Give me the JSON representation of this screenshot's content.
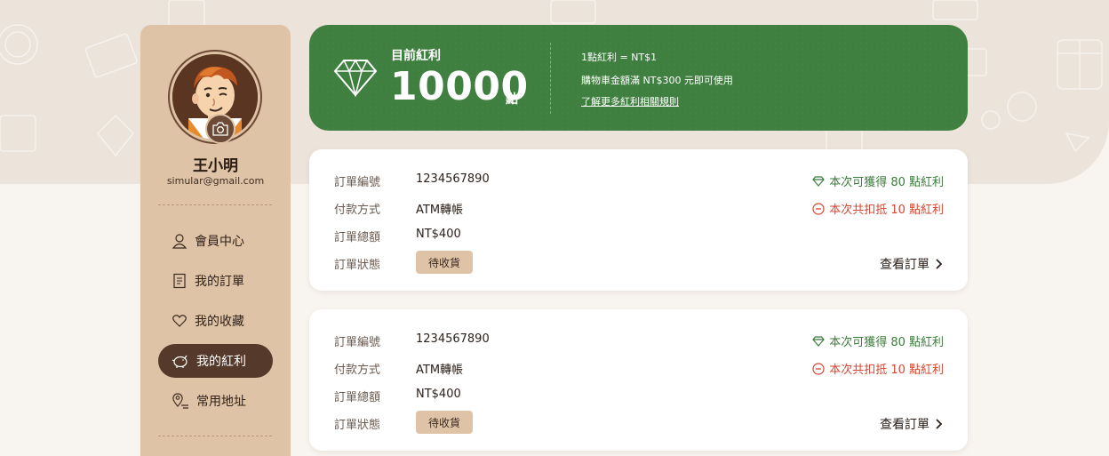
{
  "user": {
    "name": "王小明",
    "email": "simular@gmail.com"
  },
  "menu": {
    "items": [
      {
        "label": "會員中心",
        "icon": "user-icon"
      },
      {
        "label": "我的訂單",
        "icon": "receipt-icon"
      },
      {
        "label": "我的收藏",
        "icon": "heart-icon"
      },
      {
        "label": "我的紅利",
        "icon": "piggy-bank-icon",
        "active": true
      },
      {
        "label": "常用地址",
        "icon": "location-pin-icon"
      }
    ]
  },
  "bonus": {
    "title": "目前紅利",
    "points": "10000",
    "unit": "點",
    "rule1": "1點紅利 = NT$1",
    "rule2": "購物車金額滿 NT$300 元即可使用",
    "link": "了解更多紅利相關規則"
  },
  "labels": {
    "order_no": "訂單編號",
    "payment": "付款方式",
    "total": "訂單總額",
    "status": "訂單狀態",
    "view": "查看訂單"
  },
  "orders": [
    {
      "order_no": "1234567890",
      "payment": "ATM轉帳",
      "total": "NT$400",
      "status": "待收貨",
      "gain": "本次可獲得 80 點紅利",
      "deduct": "本次共扣抵 10 點紅利"
    },
    {
      "order_no": "1234567890",
      "payment": "ATM轉帳",
      "total": "NT$400",
      "status": "待收貨",
      "gain": "本次可獲得 80 點紅利",
      "deduct": "本次共扣抵 10 點紅利"
    }
  ],
  "colors": {
    "banner": "#3f7f3f",
    "sidebar": "#dfc3a6",
    "active_menu": "#55392a",
    "gain": "#3b7b3b",
    "deduct": "#d6452e"
  }
}
